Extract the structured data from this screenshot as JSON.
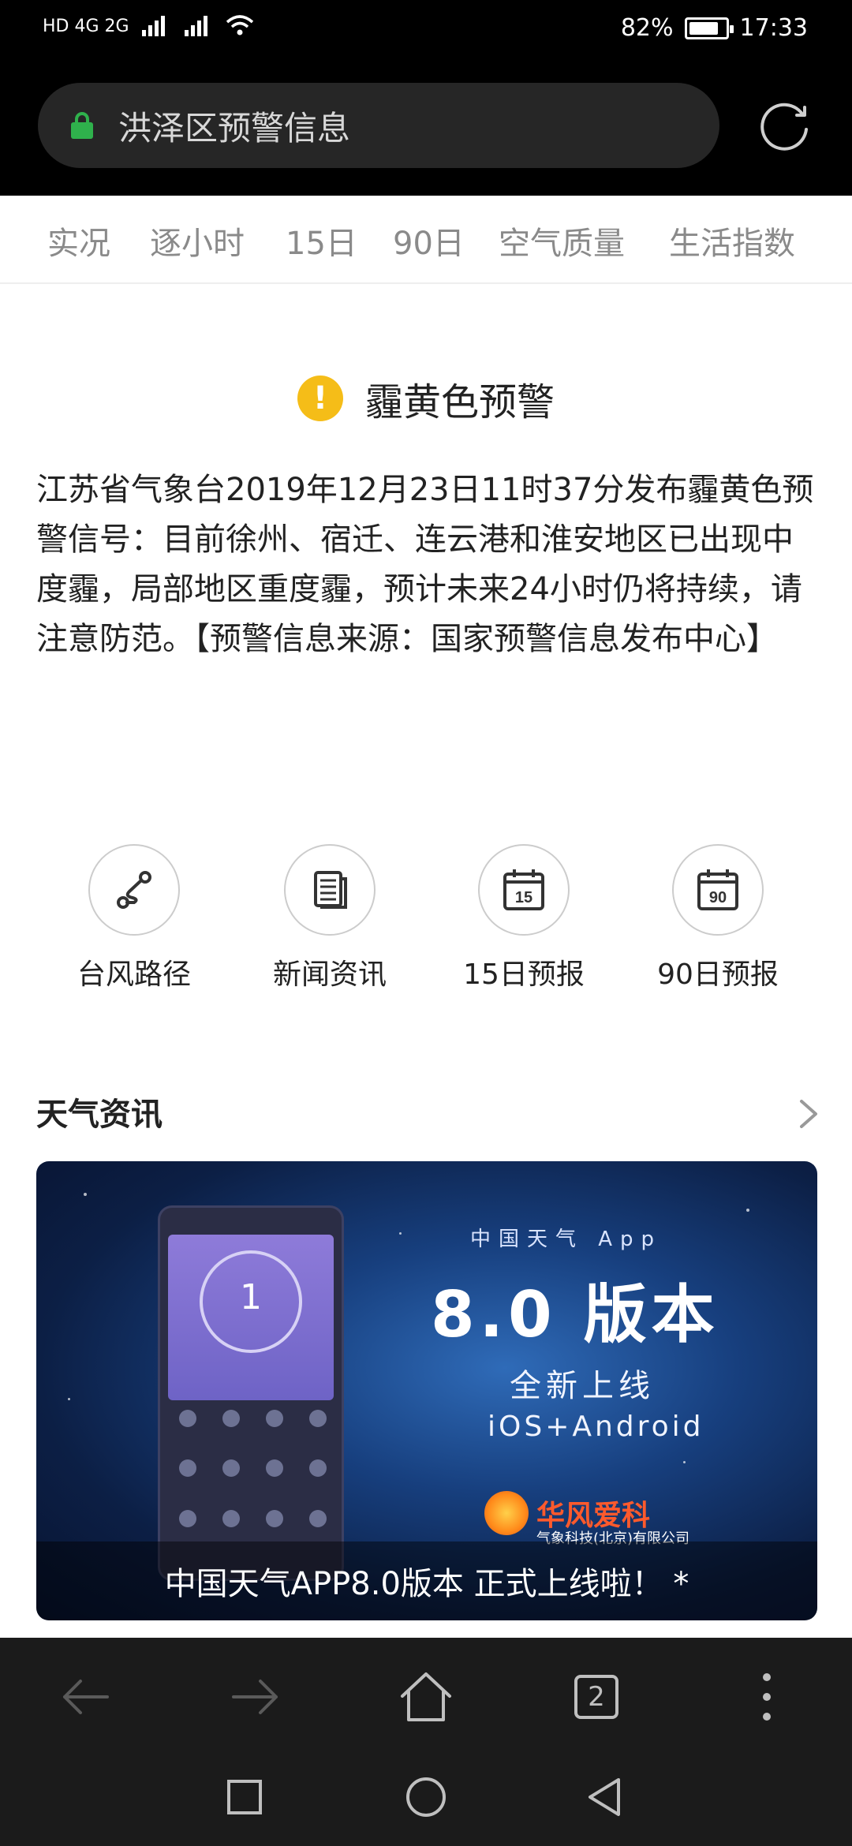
{
  "status_bar": {
    "left_indicators": "HD 4G 2G",
    "battery_percent": "82%",
    "battery_level": 0.82,
    "time": "17:33"
  },
  "address_bar": {
    "url_text": "洪泽区预警信息",
    "lock_icon": "lock-icon",
    "refresh_icon": "refresh-icon"
  },
  "tabs": [
    {
      "label": "实况"
    },
    {
      "label": "逐小时"
    },
    {
      "label": "15日"
    },
    {
      "label": "90日"
    },
    {
      "label": "空气质量"
    },
    {
      "label": "生活指数"
    }
  ],
  "warning": {
    "icon_glyph": "!",
    "icon_color": "#f5bd18",
    "title": "霾黄色预警",
    "body": "江苏省气象台2019年12月23日11时37分发布霾黄色预警信号：目前徐州、宿迁、连云港和淮安地区已出现中度霾，局部地区重度霾，预计未来24小时仍将持续，请注意防范。【预警信息来源：国家预警信息发布中心】"
  },
  "quick_links": [
    {
      "label": "台风路径",
      "icon": "typhoon-path-icon"
    },
    {
      "label": "新闻资讯",
      "icon": "news-icon"
    },
    {
      "label": "15日预报",
      "icon": "calendar-15-icon",
      "badge": "15"
    },
    {
      "label": "90日预报",
      "icon": "calendar-90-icon",
      "badge": "90"
    }
  ],
  "news": {
    "section_title": "天气资讯",
    "banner": {
      "app_line": "中国天气 App",
      "version": "8.0 版本",
      "sub1": "全新上线",
      "sub2": "iOS+Android",
      "brand_name": "华风爱科",
      "brand_company": "气象科技(北京)有限公司",
      "phone_value": "1",
      "caption": "中国天气APP8.0版本 正式上线啦！ *"
    }
  },
  "toolbar": {
    "back_icon": "back-arrow-icon",
    "forward_icon": "forward-arrow-icon",
    "home_icon": "home-icon",
    "tab_count": "2",
    "menu_icon": "more-vert-icon"
  },
  "system_nav": {
    "recent_icon": "square-icon",
    "home_icon": "circle-icon",
    "back_icon": "triangle-back-icon"
  }
}
